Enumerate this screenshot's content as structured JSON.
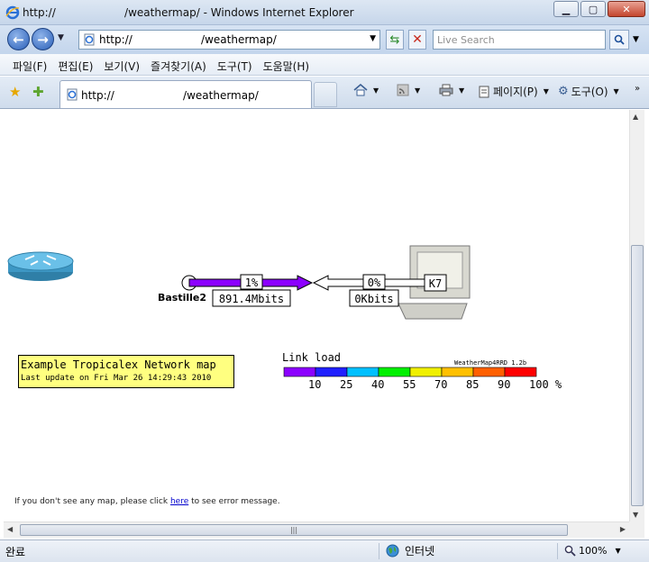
{
  "window": {
    "title": "http://                    /weathermap/ - Windows Internet Explorer",
    "minimize_glyph": "▁",
    "maximize_glyph": "▢",
    "close_glyph": "✕"
  },
  "address_bar": {
    "url": "http://                    /weathermap/",
    "search_placeholder": "Live Search"
  },
  "menu": [
    "파일(F)",
    "편집(E)",
    "보기(V)",
    "즐겨찾기(A)",
    "도구(T)",
    "도움말(H)"
  ],
  "tab": {
    "label": "http://                    /weathermap/"
  },
  "command_bar": {
    "page_label": "페이지(P)",
    "tools_label": "도구(O)"
  },
  "icons": {
    "back": "back-arrow-icon",
    "forward": "forward-arrow-icon",
    "refresh": "refresh-icon",
    "stop": "stop-icon",
    "search": "search-icon",
    "favorites": "favorites-star-icon",
    "add_favorite": "add-favorite-icon",
    "home": "home-icon",
    "feeds": "feeds-icon",
    "print": "print-icon",
    "page": "page-icon",
    "tools": "gear-icon",
    "internet_zone": "globe-icon",
    "zoom": "magnifier-icon"
  },
  "weathermap": {
    "router_label": "Bastille2",
    "host_label": "K7",
    "link_out": {
      "percent": "1%",
      "rate": "891.4Mbits",
      "load_fraction": 0.01,
      "color": "#8c00ff"
    },
    "link_in": {
      "percent": "0%",
      "rate": "0Kbits",
      "load_fraction": 0.0,
      "color": "#ffffff"
    },
    "scale": {
      "title": "Link load",
      "credit": "WeatherMap4RRD 1.2b",
      "colors": [
        "#8c00ff",
        "#2020ff",
        "#00c0ff",
        "#00f000",
        "#f0f000",
        "#ffc000",
        "#ff6000",
        "#ff0000"
      ],
      "ticks": [
        "10",
        "25",
        "40",
        "55",
        "70",
        "85",
        "90",
        "100 %"
      ]
    },
    "title_box": {
      "title": "Example Tropicalex Network map",
      "updated": "Last update on Fri Mar 26 14:29:43 2010"
    },
    "hint": {
      "before": "If you don't see any map, please click ",
      "link": "here",
      "after": " to see error message."
    }
  },
  "status_bar": {
    "status": "완료",
    "zone": "인터넷",
    "zoom": "100%"
  },
  "scrollbar": {
    "h_thumb_glyph": "|||"
  }
}
